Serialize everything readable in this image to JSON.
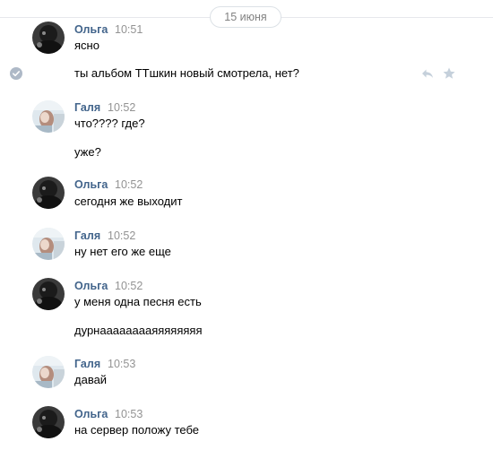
{
  "date_divider": "15 июня",
  "messages": [
    {
      "sender": "Ольга",
      "time": "10:51",
      "lines": [
        "ясно",
        "ты альбом ТТшкин новый смотрела, нет?"
      ]
    },
    {
      "sender": "Галя",
      "time": "10:52",
      "lines": [
        "что???? где?",
        "уже?"
      ]
    },
    {
      "sender": "Ольга",
      "time": "10:52",
      "lines": [
        "сегодня же выходит"
      ]
    },
    {
      "sender": "Галя",
      "time": "10:52",
      "lines": [
        "ну нет его же еще"
      ]
    },
    {
      "sender": "Ольга",
      "time": "10:52",
      "lines": [
        "у меня одна песня есть",
        "дурнааааааааяяяяяяяя"
      ]
    },
    {
      "sender": "Галя",
      "time": "10:53",
      "lines": [
        "давай"
      ]
    },
    {
      "sender": "Ольга",
      "time": "10:53",
      "lines": [
        "на сервер положу тебе"
      ]
    }
  ],
  "icons": {
    "selected": "check-circle-icon",
    "reply": "reply-icon",
    "favorite": "star-icon"
  },
  "colors": {
    "sender_name": "#42648b",
    "timestamp": "#939393",
    "accent": "#5181b8"
  }
}
